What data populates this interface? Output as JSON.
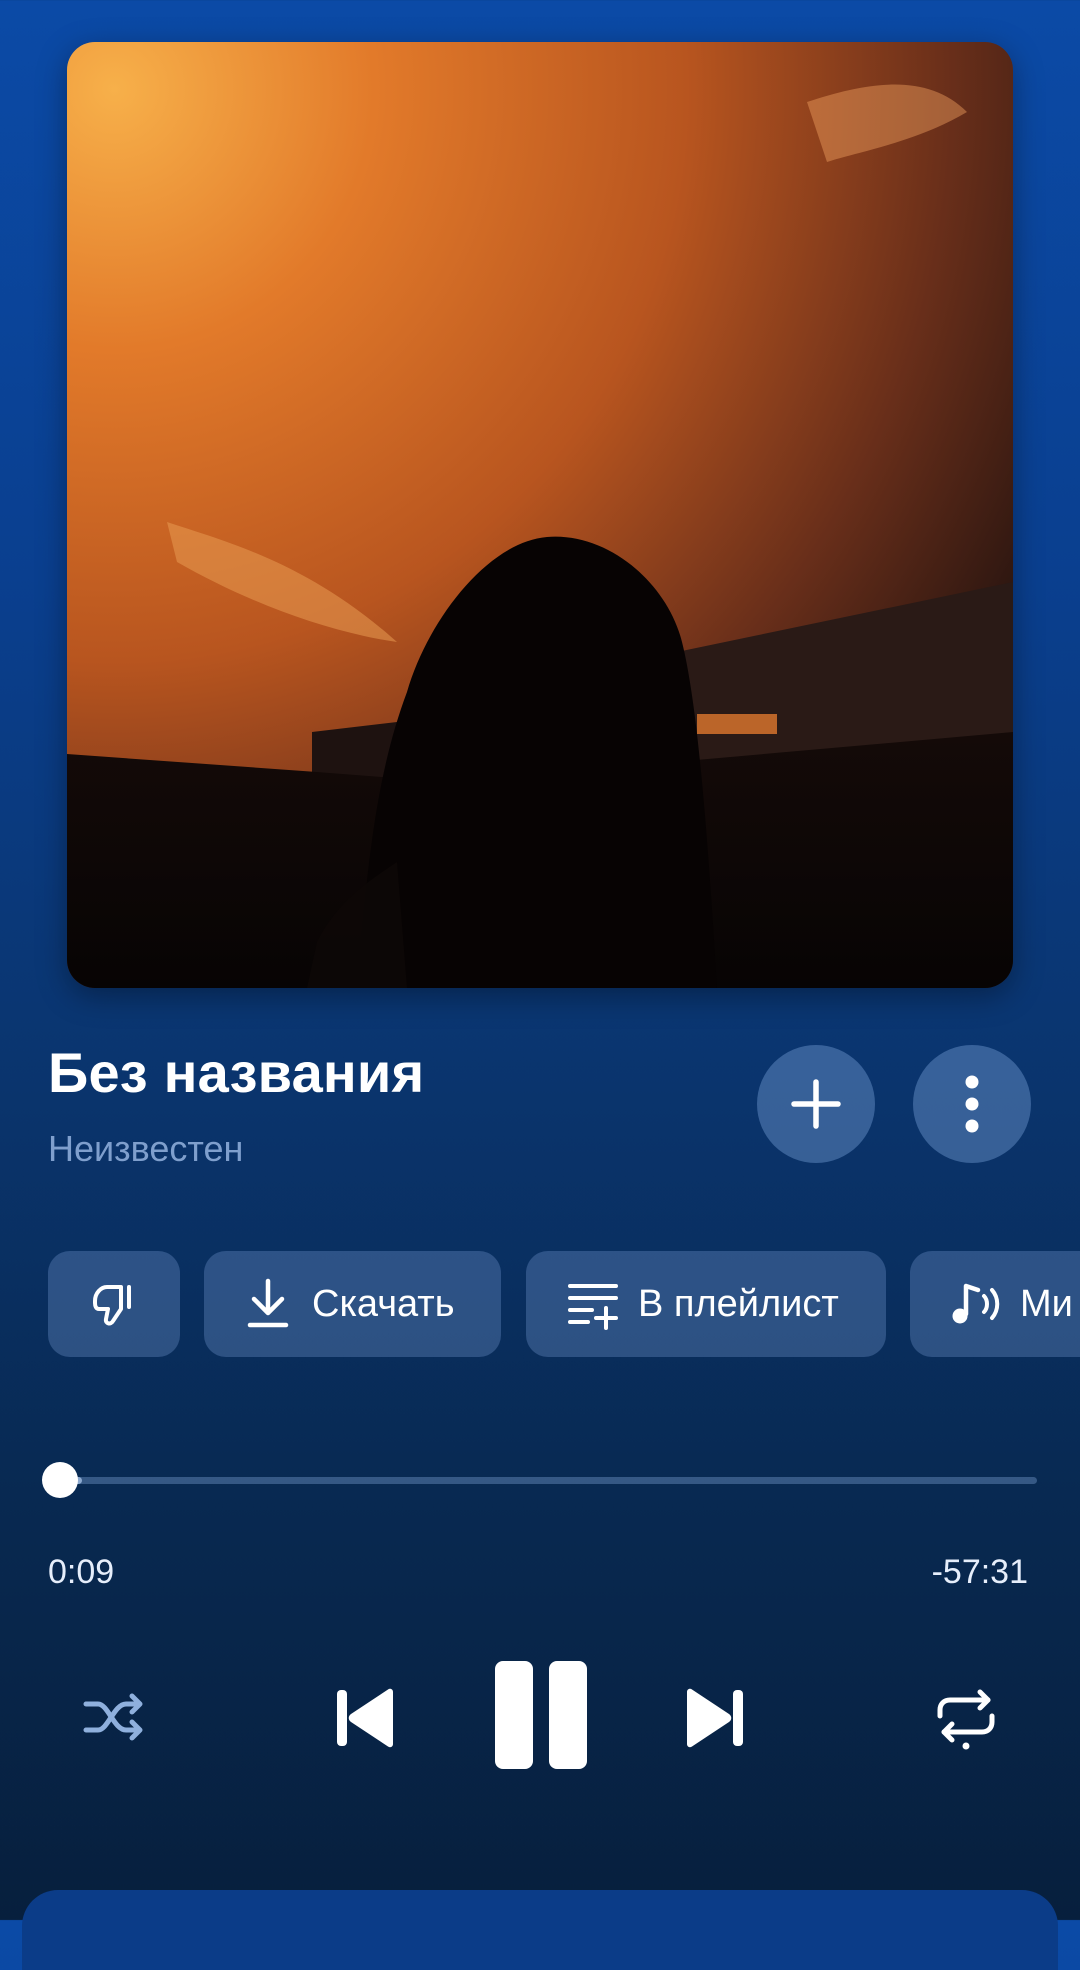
{
  "track": {
    "title": "Без названия",
    "artist": "Неизвестен"
  },
  "actions": {
    "download_label": "Скачать",
    "playlist_label": "В плейлист",
    "mix_label": "Ми"
  },
  "playback": {
    "elapsed": "0:09",
    "remaining": "-57:31",
    "progress_fraction": 0.003,
    "state": "playing"
  },
  "icons": {
    "add": "plus-icon",
    "more": "more-vertical-icon",
    "dislike": "thumbs-down-icon",
    "download": "download-icon",
    "playlist": "playlist-add-icon",
    "mix": "music-wave-icon",
    "shuffle": "shuffle-icon",
    "previous": "skip-previous-icon",
    "pause": "pause-icon",
    "next": "skip-next-icon",
    "repeat": "repeat-icon"
  },
  "colors": {
    "background_top": "#0b4aa6",
    "background_bottom": "#071f3d",
    "secondary_text": "#7f9fcd",
    "chip_bg": "#4f72a8"
  }
}
